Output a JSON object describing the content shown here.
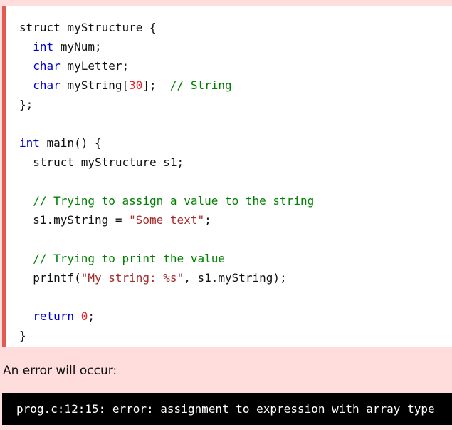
{
  "code": {
    "lines": [
      [
        {
          "t": "struct myStructure {"
        }
      ],
      [
        {
          "t": "  "
        },
        {
          "t": "int",
          "c": "kw"
        },
        {
          "t": " myNum;"
        }
      ],
      [
        {
          "t": "  "
        },
        {
          "t": "char",
          "c": "kw"
        },
        {
          "t": " myLetter;"
        }
      ],
      [
        {
          "t": "  "
        },
        {
          "t": "char",
          "c": "kw"
        },
        {
          "t": " myString["
        },
        {
          "t": "30",
          "c": "num"
        },
        {
          "t": "];  "
        },
        {
          "t": "// String",
          "c": "com"
        }
      ],
      [
        {
          "t": "};"
        }
      ],
      [
        {
          "t": ""
        }
      ],
      [
        {
          "t": "int",
          "c": "kw"
        },
        {
          "t": " main() {"
        }
      ],
      [
        {
          "t": "  struct myStructure s1;"
        }
      ],
      [
        {
          "t": ""
        }
      ],
      [
        {
          "t": "  "
        },
        {
          "t": "// Trying to assign a value to the string",
          "c": "com"
        }
      ],
      [
        {
          "t": "  s1.myString = "
        },
        {
          "t": "\"Some text\"",
          "c": "str"
        },
        {
          "t": ";"
        }
      ],
      [
        {
          "t": ""
        }
      ],
      [
        {
          "t": "  "
        },
        {
          "t": "// Trying to print the value",
          "c": "com"
        }
      ],
      [
        {
          "t": "  printf("
        },
        {
          "t": "\"My string: %s\"",
          "c": "str"
        },
        {
          "t": ", s1.myString);"
        }
      ],
      [
        {
          "t": ""
        }
      ],
      [
        {
          "t": "  "
        },
        {
          "t": "return",
          "c": "kw"
        },
        {
          "t": " "
        },
        {
          "t": "0",
          "c": "num"
        },
        {
          "t": ";"
        }
      ],
      [
        {
          "t": "}"
        }
      ]
    ]
  },
  "error_label": "An error will occur:",
  "terminal": {
    "output": "prog.c:12:15: error: assignment to expression with array type"
  }
}
